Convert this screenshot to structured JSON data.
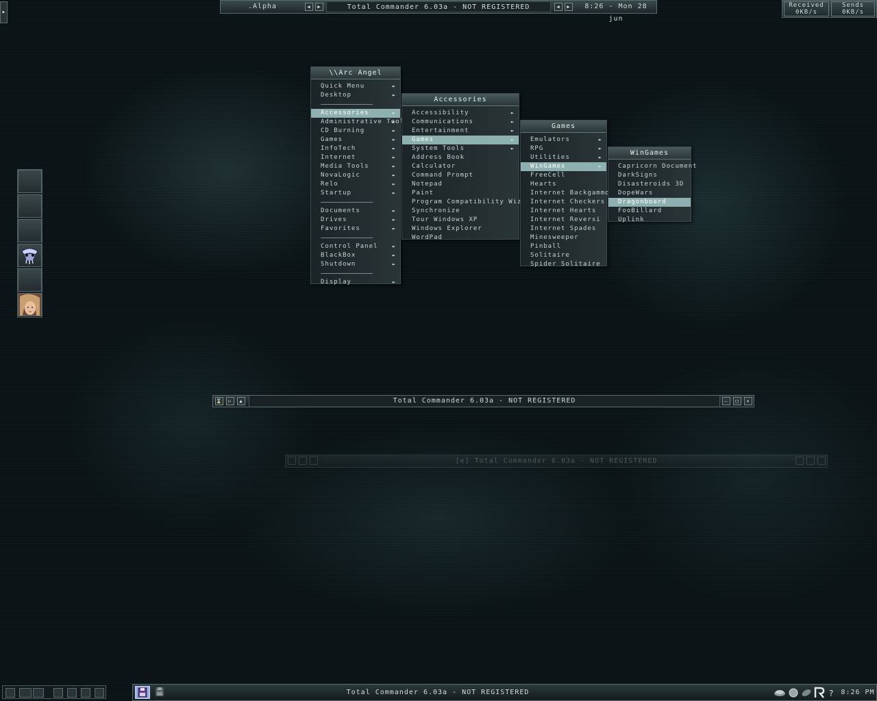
{
  "top_bar": {
    "workspace": ".Alpha",
    "window_title": "Total Commander 6.03a - NOT REGISTERED",
    "clock": "8:26 - Mon 28 jun",
    "net_received_label": "Received",
    "net_received_value": "0KB/s",
    "net_sends_label": "Sends",
    "net_sends_value": "0KB/s"
  },
  "menus": {
    "root": {
      "title": "\\\\Arc Angel",
      "items": [
        "Quick Menu",
        "Desktop",
        "Accessories",
        "Administrative Tools",
        "CD Burning",
        "Games",
        "InfoTech",
        "Internet",
        "Media Tools",
        "NovaLogic",
        "Relo",
        "Startup",
        "Documents",
        "Drives",
        "Favorites",
        "Control Panel",
        "BlackBox",
        "Shutdown",
        "Display"
      ]
    },
    "accessories": {
      "title": "Accessories",
      "items": [
        "Accessibility",
        "Communications",
        "Entertainment",
        "Games",
        "System Tools",
        "Address Book",
        "Calculator",
        "Command Prompt",
        "Notepad",
        "Paint",
        "Program Compatibility Wizard",
        "Synchronize",
        "Tour Windows XP",
        "Windows Explorer",
        "WordPad"
      ]
    },
    "games": {
      "title": "Games",
      "items": [
        "Emulators",
        "RPG",
        "Utilities",
        "WinGames",
        "FreeCell",
        "Hearts",
        "Internet Backgammon",
        "Internet Checkers",
        "Internet Hearts",
        "Internet Reversi",
        "Internet Spades",
        "Minesweeper",
        "Pinball",
        "Solitaire",
        "Spider Solitaire"
      ]
    },
    "wingames": {
      "title": "WinGames",
      "items": [
        "Capricorn Document",
        "DarkSigns",
        "Disasteroids 3D",
        "DopeWars",
        "Dragonboard",
        "FooBillard",
        "Uplink"
      ]
    }
  },
  "windows": {
    "main_title": "Total Commander 6.03a - NOT REGISTERED",
    "ghost_title": "[e] Total Commander 6.03a - NOT REGISTERED"
  },
  "taskbar": {
    "task_title": "Total Commander 6.03a - NOT REGISTERED",
    "clock": "8:26 PM"
  },
  "colors": {
    "accent": "#8fb0b0",
    "background": "#0d1719"
  }
}
